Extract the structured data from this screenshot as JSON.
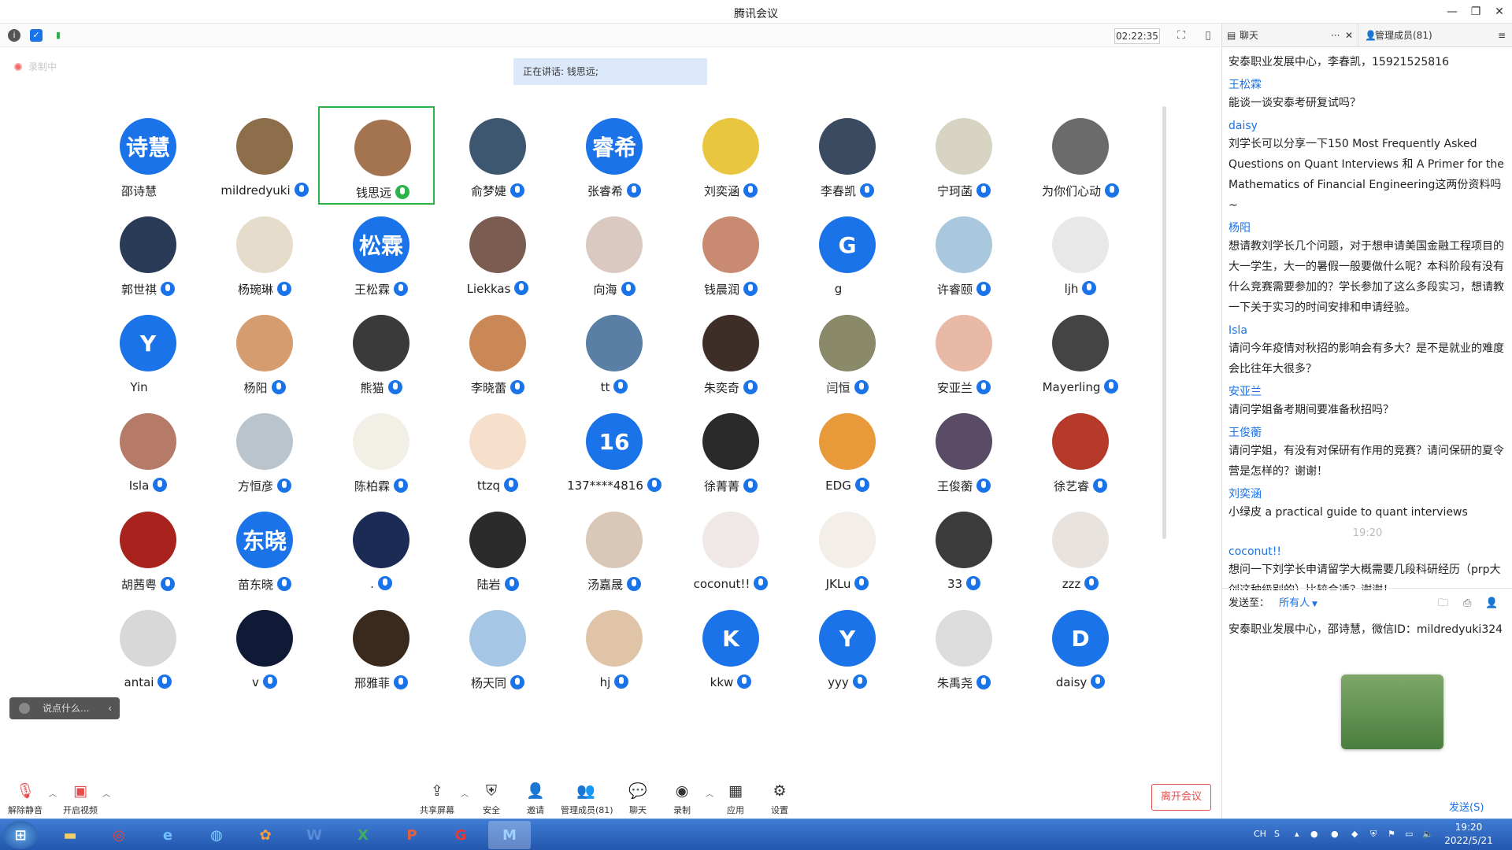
{
  "window": {
    "title": "腾讯会议",
    "minimize": "—",
    "restore": "❐",
    "close": "✕"
  },
  "topbar": {
    "info_icon": "i",
    "shield_icon": "✓",
    "signal_icon": "▮",
    "timer": "02:22:35",
    "fullscreen_icon": "⛶",
    "layout_icon": "▯"
  },
  "recording": {
    "label": "录制中"
  },
  "speaking": {
    "label": "正在讲话: 钱思远;"
  },
  "participants": [
    {
      "name": "邵诗慧",
      "avatar_text": "诗慧",
      "color": "#1a73e8",
      "mic": "none"
    },
    {
      "name": "mildredyuki",
      "avatar_text": "",
      "color": "#8d6e4b",
      "mic": "blue"
    },
    {
      "name": "钱思远",
      "avatar_text": "",
      "color": "#a47451",
      "mic": "green",
      "active": true
    },
    {
      "name": "俞梦婕",
      "avatar_text": "",
      "color": "#3d5770",
      "mic": "blue"
    },
    {
      "name": "张睿希",
      "avatar_text": "睿希",
      "color": "#1a73e8",
      "mic": "blue"
    },
    {
      "name": "刘奕涵",
      "avatar_text": "",
      "color": "#e8c640",
      "mic": "blue"
    },
    {
      "name": "李春凯",
      "avatar_text": "",
      "color": "#3a4a60",
      "mic": "blue"
    },
    {
      "name": "宁珂菡",
      "avatar_text": "",
      "color": "#d8d4c4",
      "mic": "blue"
    },
    {
      "name": "为你们心动",
      "avatar_text": "",
      "color": "#6b6b6b",
      "mic": "blue"
    },
    {
      "name": "郭世祺",
      "avatar_text": "",
      "color": "#2a3b58",
      "mic": "blue"
    },
    {
      "name": "杨琬琳",
      "avatar_text": "",
      "color": "#e6dccb",
      "mic": "blue"
    },
    {
      "name": "王松霖",
      "avatar_text": "松霖",
      "color": "#1a73e8",
      "mic": "blue"
    },
    {
      "name": "Liekkas",
      "avatar_text": "",
      "color": "#7a5c50",
      "mic": "blue"
    },
    {
      "name": "向海",
      "avatar_text": "",
      "color": "#d9c9c0",
      "mic": "blue"
    },
    {
      "name": "钱晨润",
      "avatar_text": "",
      "color": "#c98a72",
      "mic": "blue"
    },
    {
      "name": "g",
      "avatar_text": "G",
      "color": "#1a73e8",
      "mic": "none"
    },
    {
      "name": "许睿颐",
      "avatar_text": "",
      "color": "#a9c8de",
      "mic": "blue"
    },
    {
      "name": "ljh",
      "avatar_text": "",
      "color": "#e8e8e8",
      "mic": "blue"
    },
    {
      "name": "Yin",
      "avatar_text": "Y",
      "color": "#1a73e8",
      "mic": "none"
    },
    {
      "name": "杨阳",
      "avatar_text": "",
      "color": "#d59c6f",
      "mic": "blue"
    },
    {
      "name": "熊猫",
      "avatar_text": "",
      "color": "#3a3a3a",
      "mic": "blue"
    },
    {
      "name": "李晓蕾",
      "avatar_text": "",
      "color": "#c98855",
      "mic": "blue"
    },
    {
      "name": "tt",
      "avatar_text": "",
      "color": "#5a7fa5",
      "mic": "blue"
    },
    {
      "name": "朱奕奇",
      "avatar_text": "",
      "color": "#3d2f28",
      "mic": "blue"
    },
    {
      "name": "闫恒",
      "avatar_text": "",
      "color": "#8a8a6a",
      "mic": "blue"
    },
    {
      "name": "安亚兰",
      "avatar_text": "",
      "color": "#e9b9a8",
      "mic": "blue"
    },
    {
      "name": "Mayerling",
      "avatar_text": "",
      "color": "#444",
      "mic": "blue"
    },
    {
      "name": "Isla",
      "avatar_text": "",
      "color": "#b57a68",
      "mic": "blue"
    },
    {
      "name": "方恒彦",
      "avatar_text": "",
      "color": "#b9c4cc",
      "mic": "blue"
    },
    {
      "name": "陈柏霖",
      "avatar_text": "",
      "color": "#f2efe6",
      "mic": "blue"
    },
    {
      "name": "ttzq",
      "avatar_text": "",
      "color": "#f6e0cc",
      "mic": "blue"
    },
    {
      "name": "137****4816",
      "avatar_text": "16",
      "color": "#1a73e8",
      "mic": "blue"
    },
    {
      "name": "徐菁菁",
      "avatar_text": "",
      "color": "#2a2a2a",
      "mic": "blue"
    },
    {
      "name": "EDG",
      "avatar_text": "",
      "color": "#e89a3a",
      "mic": "blue"
    },
    {
      "name": "王俊蘅",
      "avatar_text": "",
      "color": "#5a4c66",
      "mic": "blue"
    },
    {
      "name": "徐艺睿",
      "avatar_text": "",
      "color": "#b63a2a",
      "mic": "blue"
    },
    {
      "name": "胡茜粤",
      "avatar_text": "",
      "color": "#a8221e",
      "mic": "blue"
    },
    {
      "name": "苗东晓",
      "avatar_text": "东晓",
      "color": "#1a73e8",
      "mic": "blue"
    },
    {
      "name": ".",
      "avatar_text": "",
      "color": "#1b2b55",
      "mic": "blue"
    },
    {
      "name": "陆岩",
      "avatar_text": "",
      "color": "#2b2b2b",
      "mic": "blue"
    },
    {
      "name": "汤嘉晟",
      "avatar_text": "",
      "color": "#d9c8b8",
      "mic": "blue"
    },
    {
      "name": "coconut!!",
      "avatar_text": "",
      "color": "#efe8e6",
      "mic": "blue"
    },
    {
      "name": "JKLu",
      "avatar_text": "",
      "color": "#f3efe8",
      "mic": "blue"
    },
    {
      "name": "33",
      "avatar_text": "",
      "color": "#3b3b3b",
      "mic": "blue"
    },
    {
      "name": "zzz",
      "avatar_text": "",
      "color": "#e8e3df",
      "mic": "blue"
    },
    {
      "name": "antai",
      "avatar_text": "",
      "color": "#d8d8d8",
      "mic": "blue"
    },
    {
      "name": "v",
      "avatar_text": "",
      "color": "#0f1a36",
      "mic": "blue"
    },
    {
      "name": "邢雅菲",
      "avatar_text": "",
      "color": "#3a2a1e",
      "mic": "blue"
    },
    {
      "name": "杨天同",
      "avatar_text": "",
      "color": "#a5c7e5",
      "mic": "blue"
    },
    {
      "name": "hj",
      "avatar_text": "",
      "color": "#e0c4a8",
      "mic": "blue"
    },
    {
      "name": "kkw",
      "avatar_text": "K",
      "color": "#1a73e8",
      "mic": "blue"
    },
    {
      "name": "yyy",
      "avatar_text": "Y",
      "color": "#1a73e8",
      "mic": "blue"
    },
    {
      "name": "朱禹尧",
      "avatar_text": "",
      "color": "#dcdcdc",
      "mic": "blue"
    },
    {
      "name": "daisy",
      "avatar_text": "D",
      "color": "#1a73e8",
      "mic": "blue"
    }
  ],
  "chat_input": {
    "placeholder": "说点什么..."
  },
  "toolbar": {
    "unmute": "解除静音",
    "start_video": "开启视频",
    "share": "共享屏幕",
    "security": "安全",
    "invite": "邀请",
    "members": "管理成员(81)",
    "chat": "聊天",
    "record": "录制",
    "apps": "应用",
    "settings": "设置",
    "leave": "离开会议"
  },
  "panel": {
    "tab_chat": "聊天",
    "tab_members": "管理成员(81)",
    "more": "···",
    "close": "✕",
    "messages": [
      {
        "sender": "",
        "text": "安泰职业发展中心，李春凯，15921525816"
      },
      {
        "sender": "王松霖",
        "text": "能谈一谈安泰考研复试吗？"
      },
      {
        "sender": "daisy",
        "text": "刘学长可以分享一下150 Most Frequently Asked Questions on Quant Interviews 和 A Primer for the Mathematics of Financial Engineering这两份资料吗~"
      },
      {
        "sender": "杨阳",
        "text": "想请教刘学长几个问题，对于想申请美国金融工程项目的大一学生，大一的暑假一般要做什么呢？本科阶段有没有什么竞赛需要参加的？学长参加了这么多段实习，想请教一下关于实习的时间安排和申请经验。"
      },
      {
        "sender": "Isla",
        "text": "请问今年疫情对秋招的影响会有多大？是不是就业的难度会比往年大很多？"
      },
      {
        "sender": "安亚兰",
        "text": "请问学姐备考期间要准备秋招吗？"
      },
      {
        "sender": "王俊蘅",
        "text": "请问学姐，有没有对保研有作用的竞赛？请问保研的夏令营是怎样的？谢谢！"
      },
      {
        "sender": "刘奕涵",
        "text": "小绿皮 a practical guide to quant interviews"
      },
      {
        "sender": "",
        "time": "19:20",
        "text": ""
      },
      {
        "sender": "coconut!!",
        "text": "想问一下刘学长申请留学大概需要几段科研经历（prp大创这种级别的）比较合适？谢谢！"
      }
    ],
    "send_to_label": "发送至：",
    "send_to_value": "所有人",
    "draft": "安泰职业发展中心，邵诗慧，微信ID：mildredyuki324",
    "send_button": "发送(S)"
  },
  "taskbar": {
    "ime": "CH",
    "time": "19:20",
    "date": "2022/5/21"
  }
}
